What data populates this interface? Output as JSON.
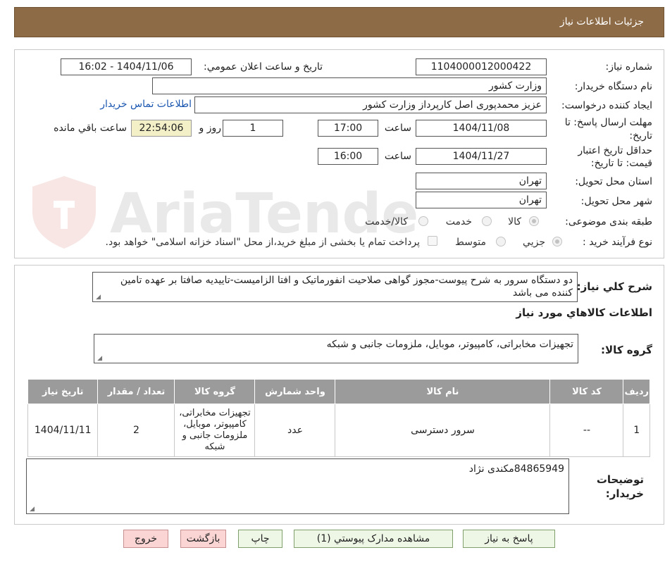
{
  "header": {
    "title": "جزئیات اطلاعات نیاز"
  },
  "form": {
    "need_number_label": "شماره نیاز:",
    "need_number": "1104000012000422",
    "announce_label": "تاریخ و ساعت اعلان عمومي:",
    "announce_value": "1404/11/06 - 16:02",
    "buyer_org_label": "نام دستگاه خریدار:",
    "buyer_org": "وزارت کشور",
    "requester_label": "ایجاد کننده درخواست:",
    "requester": "عزیز محمدپوری اصل کارپرداز وزارت کشور",
    "buyer_contact_link": "اطلاعات تماس خریدار",
    "deadline_label_1": "مهلت ارسال پاسخ: تا",
    "deadline_label_2": "تاریخ:",
    "deadline_date": "1404/11/08",
    "time_label": "ساعت",
    "deadline_time": "17:00",
    "days_value": "1",
    "days_label": "روز و",
    "remaining_time": "22:54:06",
    "remaining_label": "ساعت باقي مانده",
    "validity_label_1": "حداقل تاریخ اعتبار",
    "validity_label_2": "قیمت: تا تاریخ:",
    "validity_date": "1404/11/27",
    "validity_time": "16:00",
    "province_label": "استان محل تحویل:",
    "province": "تهران",
    "city_label": "شهر محل تحویل:",
    "city": "تهران",
    "category_label": "طبقه بندی موضوعی:",
    "category_options": [
      "کالا",
      "خدمت",
      "کالا/خدمت"
    ],
    "purchase_type_label": "نوع فرآیند خرید :",
    "purchase_type_options": [
      "جزیي",
      "متوسط"
    ],
    "purchase_note": "پرداخت تمام یا بخشی از مبلغ خرید،از محل \"اسناد خزانه اسلامی\" خواهد بود."
  },
  "watermark": {
    "text": "AriaTender.neT"
  },
  "summary": {
    "label": "شرح کلي نیاز:",
    "text": "دو دستگاه سرور به شرح پیوست-مجوز گواهی صلاحیت انفورماتیک و افتا الزامیست-تاییدیه صافتا بر عهده تامین کننده می باشد"
  },
  "goods": {
    "section_title": "اطلاعات کالاهاي مورد نیاز",
    "group_label": "گروه کالا:",
    "group_value": "تجهیزات مخابراتی، کامپیوتر، موبایل، ملزومات جانبی و شبکه",
    "table": {
      "headers": [
        "ردیف",
        "کد کالا",
        "نام کالا",
        "واحد شمارش",
        "گروه کالا",
        "تعداد / مقدار",
        "تاریخ نیاز"
      ],
      "rows": [
        [
          "1",
          "--",
          "سرور دسترسی",
          "عدد",
          "تجهیزات مخابراتی، کامپیوتر، موبایل، ملزومات جانبی و شبکه",
          "2",
          "1404/11/11"
        ]
      ]
    }
  },
  "buyer_notes": {
    "label_1": "توضیحات",
    "label_2": "خریدار:",
    "text": "84865949مکندی نژاد"
  },
  "buttons": {
    "reply": "پاسخ به نیاز",
    "attachments": "مشاهده مدارک پیوستي (1)",
    "print": "چاپ",
    "back": "بازگشت",
    "exit": "خروج"
  }
}
